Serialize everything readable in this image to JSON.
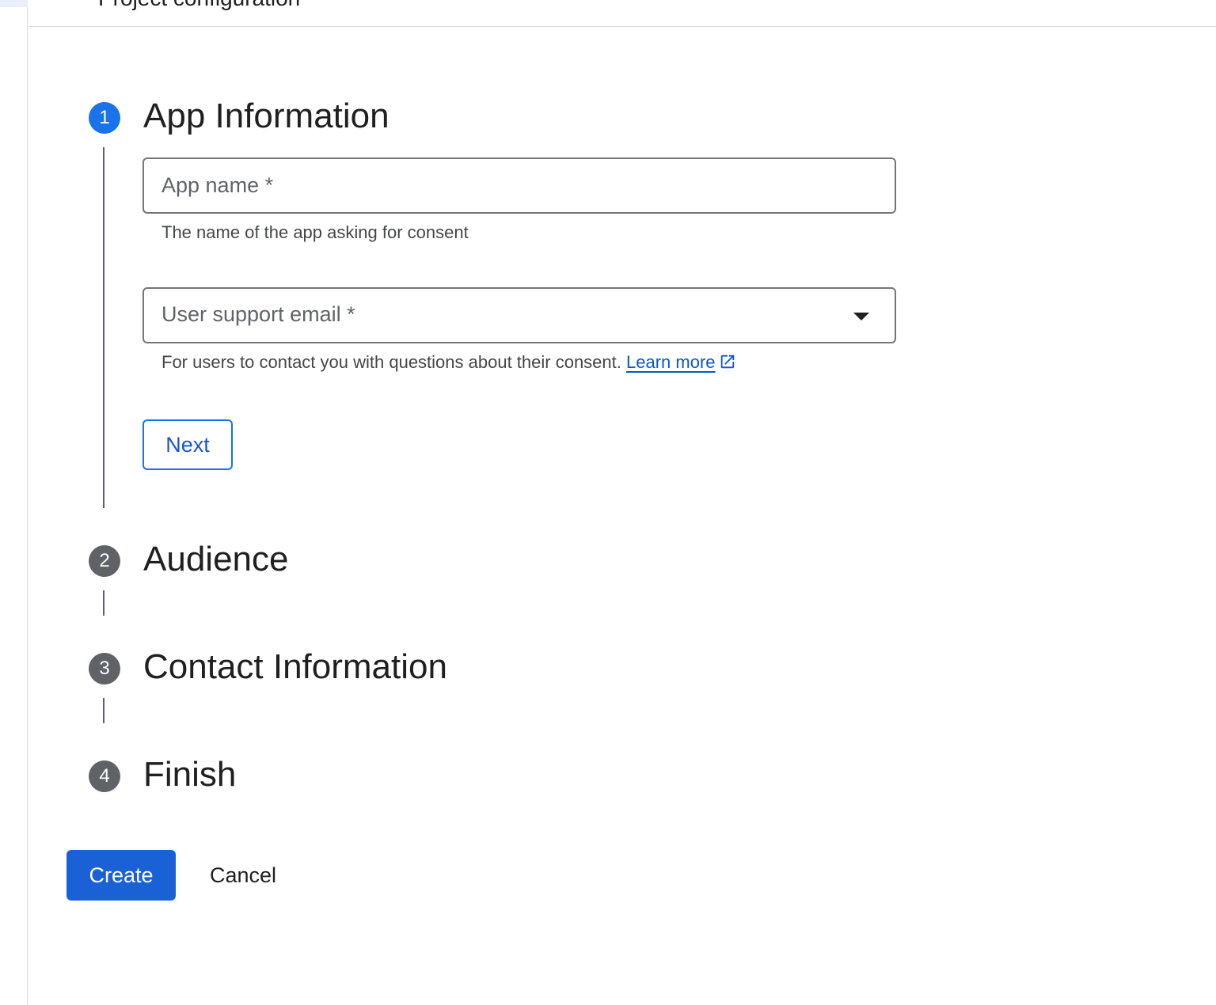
{
  "header": {
    "title": "Project configuration"
  },
  "steps": [
    {
      "number": "1",
      "title": "App Information",
      "active": true
    },
    {
      "number": "2",
      "title": "Audience",
      "active": false
    },
    {
      "number": "3",
      "title": "Contact Information",
      "active": false
    },
    {
      "number": "4",
      "title": "Finish",
      "active": false
    }
  ],
  "form": {
    "app_name": {
      "placeholder": "App name *",
      "value": "",
      "hint": "The name of the app asking for consent"
    },
    "support_email": {
      "label": "User support email *",
      "value": "",
      "hint": "For users to contact you with questions about their consent.",
      "learn_more": "Learn more"
    },
    "next_label": "Next"
  },
  "actions": {
    "create_label": "Create",
    "cancel_label": "Cancel"
  },
  "colors": {
    "primary": "#1a73e8",
    "inactive_step": "#5f6368",
    "link": "#0b57d0"
  },
  "icons": {
    "external_link": "external-link-icon",
    "dropdown": "chevron-down-icon"
  }
}
